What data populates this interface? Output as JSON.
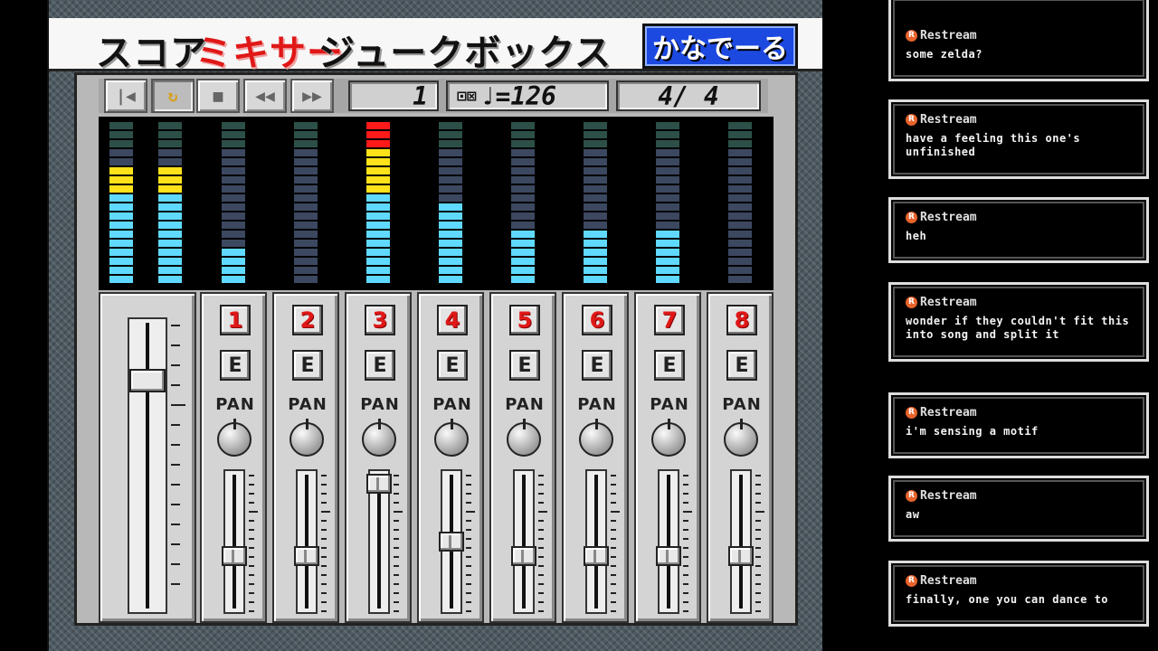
{
  "menubar": {
    "items": [
      "スコア",
      "ミキサー",
      "ジュークボックス"
    ],
    "kana_button": "かなでーる"
  },
  "toolbar": {
    "buttons": [
      {
        "name": "rewind-start",
        "glyph": "|◀"
      },
      {
        "name": "loop",
        "glyph": "↻"
      },
      {
        "name": "stop",
        "glyph": "■"
      },
      {
        "name": "rewind",
        "glyph": "◀◀"
      },
      {
        "name": "fast-forward",
        "glyph": "▶▶"
      }
    ],
    "measure": "1",
    "tempo_icons": "⊡⊠",
    "tempo": "♩=126",
    "time_signature": "4/ 4"
  },
  "meters": [
    {
      "level": 13,
      "segments": 18
    },
    {
      "level": 13,
      "segments": 18
    },
    {
      "level": 4,
      "segments": 18
    },
    {
      "level": 0,
      "segments": 18
    },
    {
      "level": 18,
      "segments": 18
    },
    {
      "level": 9,
      "segments": 18
    },
    {
      "level": 6,
      "segments": 18
    },
    {
      "level": 6,
      "segments": 18
    },
    {
      "level": 6,
      "segments": 18
    },
    {
      "level": 0,
      "segments": 18
    }
  ],
  "meter_colors": {
    "low": "#5fd9ff",
    "mid": "#ffe21a",
    "high": "#ff1a1a",
    "off": "#3c4860",
    "top_off": "#2c5048"
  },
  "master": {
    "level": 0.82
  },
  "channels": [
    {
      "number": "1",
      "e_label": "E",
      "pan_label": "PAN",
      "fader": 0.38
    },
    {
      "number": "2",
      "e_label": "E",
      "pan_label": "PAN",
      "fader": 0.38
    },
    {
      "number": "3",
      "e_label": "E",
      "pan_label": "PAN",
      "fader": 0.98
    },
    {
      "number": "4",
      "e_label": "E",
      "pan_label": "PAN",
      "fader": 0.5
    },
    {
      "number": "5",
      "e_label": "E",
      "pan_label": "PAN",
      "fader": 0.38
    },
    {
      "number": "6",
      "e_label": "E",
      "pan_label": "PAN",
      "fader": 0.38
    },
    {
      "number": "7",
      "e_label": "E",
      "pan_label": "PAN",
      "fader": 0.38
    },
    {
      "number": "8",
      "e_label": "E",
      "pan_label": "PAN",
      "fader": 0.38
    }
  ],
  "chat": {
    "messages": [
      {
        "user": "Restream",
        "text": "some zelda?"
      },
      {
        "user": "Restream",
        "text": "have a feeling this one's unfinished"
      },
      {
        "user": "Restream",
        "text": "heh"
      },
      {
        "user": "Restream",
        "text": "wonder if they couldn't fit this into song and split it"
      },
      {
        "user": "Restream",
        "text": "i'm sensing a motif"
      },
      {
        "user": "Restream",
        "text": "aw"
      },
      {
        "user": "Restream",
        "text": "finally, one you can dance to"
      }
    ]
  }
}
